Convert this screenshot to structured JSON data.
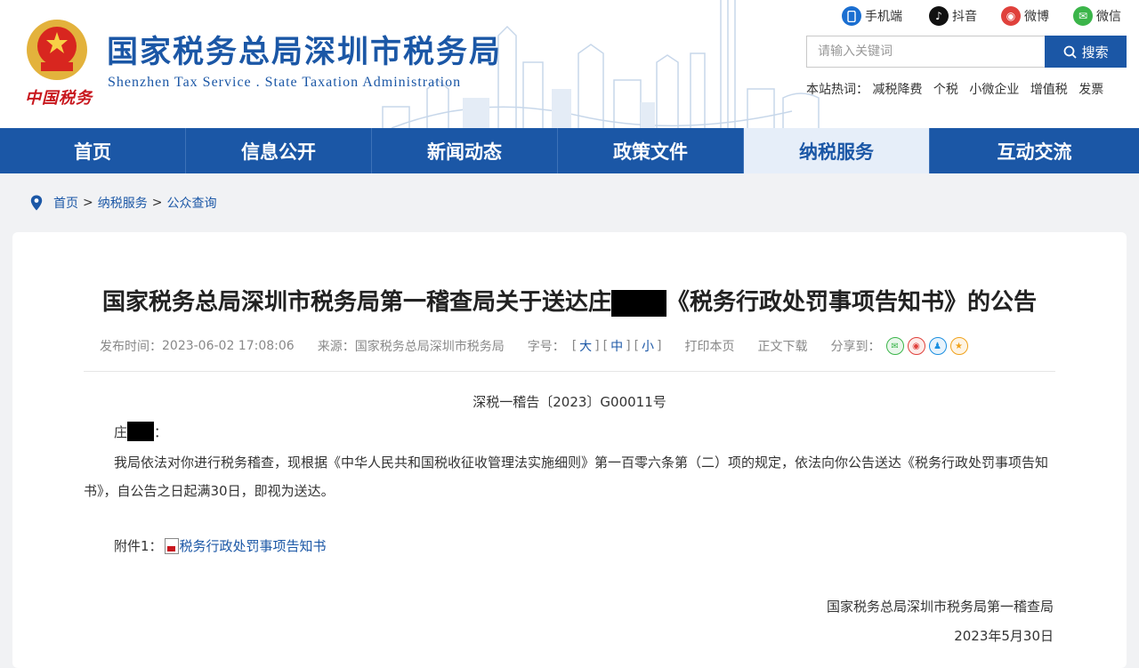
{
  "header": {
    "logo_slogan": "中国税务",
    "site_title": "国家税务总局深圳市税务局",
    "site_subtitle": "Shenzhen Tax Service . State Taxation Administration",
    "social": [
      {
        "label": "手机端",
        "icon": "mobile-icon",
        "color": "#1b6fd1"
      },
      {
        "label": "抖音",
        "icon": "douyin-icon",
        "color": "#111111"
      },
      {
        "label": "微博",
        "icon": "weibo-icon",
        "color": "#e0413c"
      },
      {
        "label": "微信",
        "icon": "wechat-icon",
        "color": "#3bb54a"
      }
    ],
    "search": {
      "placeholder": "请输入关键词",
      "button_label": "搜索"
    },
    "hot": {
      "label": "本站热词：",
      "words": [
        "减税降费",
        "个税",
        "小微企业",
        "增值税",
        "发票"
      ]
    }
  },
  "nav": {
    "items": [
      "首页",
      "信息公开",
      "新闻动态",
      "政策文件",
      "纳税服务",
      "互动交流"
    ],
    "active": "纳税服务"
  },
  "breadcrumb": {
    "items": [
      "首页",
      "纳税服务",
      "公众查询"
    ],
    "separator": ">"
  },
  "article": {
    "title_before": "国家税务总局深圳市税务局第一稽查局关于送达庄",
    "title_after": "《税务行政处罚事项告知书》的公告",
    "meta": {
      "publish_label": "发布时间：",
      "publish_time": "2023-06-02 17:08:06",
      "source_label": "来源：",
      "source": "国家税务总局深圳市税务局",
      "font_label": "字号：",
      "font_sizes": [
        "大",
        "中",
        "小"
      ],
      "print_label": "打印本页",
      "download_label": "正文下载",
      "share_label": "分享到："
    },
    "doc_number": "深税一稽告〔2023〕G00011号",
    "salutation_prefix": "庄",
    "salutation_suffix": "：",
    "body": "我局依法对你进行税务稽查，现根据《中华人民共和国税收征收管理法实施细则》第一百零六条第（二）项的规定，依法向你公告送达《税务行政处罚事项告知书》，自公告之日起满30日，即视为送达。",
    "attachment_label": "附件1：",
    "attachment_link": "税务行政处罚事项告知书",
    "signature": "国家税务总局深圳市税务局第一稽查局",
    "date": "2023年5月30日"
  },
  "colors": {
    "brand_blue": "#1b57a6",
    "nav_active_bg": "#e6eef9",
    "slogan_red": "#c8161d"
  }
}
